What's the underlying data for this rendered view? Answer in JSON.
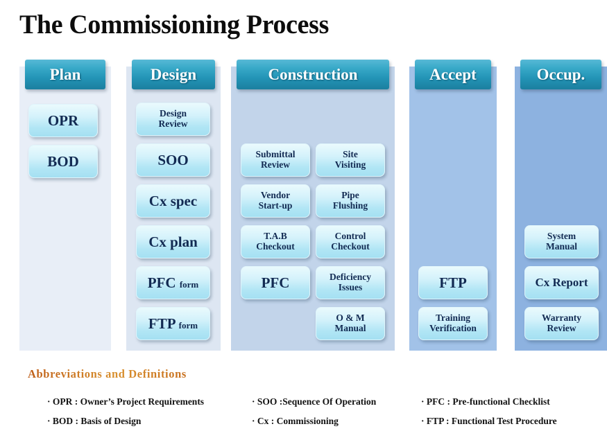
{
  "title": "The Commissioning Process",
  "columns": [
    {
      "key": "plan",
      "header": "Plan",
      "nodes": [
        {
          "label": "OPR"
        },
        {
          "label": "BOD"
        }
      ]
    },
    {
      "key": "design",
      "header": "Design",
      "nodes": [
        {
          "label": "Design\nReview"
        },
        {
          "label": "SOO"
        },
        {
          "label": "Cx spec"
        },
        {
          "label": "Cx plan"
        },
        {
          "label": "PFC form"
        },
        {
          "label": "FTP form"
        }
      ]
    },
    {
      "key": "construction",
      "header": "Construction",
      "nodes": [
        {
          "label": "Submittal\nReview"
        },
        {
          "label": "Site\nVisiting"
        },
        {
          "label": "Vendor\nStart-up"
        },
        {
          "label": "Pipe\nFlushing"
        },
        {
          "label": "T.A.B\nCheckout"
        },
        {
          "label": "Control\nCheckout"
        },
        {
          "label": "PFC"
        },
        {
          "label": "Deficiency\nIssues"
        },
        {
          "label": "O & M\nManual"
        }
      ]
    },
    {
      "key": "accept",
      "header": "Accept",
      "nodes": [
        {
          "label": "FTP"
        },
        {
          "label": "Training\nVerification"
        }
      ]
    },
    {
      "key": "occupancy",
      "header": "Occup.",
      "nodes": [
        {
          "label": "System\nManual"
        },
        {
          "label": "Cx Report"
        },
        {
          "label": "Warranty\nReview"
        }
      ]
    }
  ],
  "abbreviations": {
    "heading": "Abbreviations and Definitions",
    "items": [
      "· OPR : Owner’s Project Requirements",
      "· BOD : Basis of Design",
      "· SOO :Sequence Of Operation",
      "· Cx : Commissioning",
      "· PFC : Pre-functional Checklist",
      "· FTP : Functional Test Procedure"
    ]
  },
  "colors": {
    "header_pill_top": "#57b9d6",
    "header_pill_bottom": "#1b7f9f",
    "node_top": "#eafafd",
    "node_bottom": "#a4e0f2",
    "node_text": "#122a52",
    "title_text": "#0d0d0d",
    "abbrev_heading": "#c3661d",
    "col_plan_bg": "#e8eef7",
    "col_design_bg": "#dde6f2",
    "col_construction_bg": "#c2d4ea",
    "col_accept_bg": "#a2c2e8",
    "col_occupancy_bg": "#8db2e0"
  }
}
